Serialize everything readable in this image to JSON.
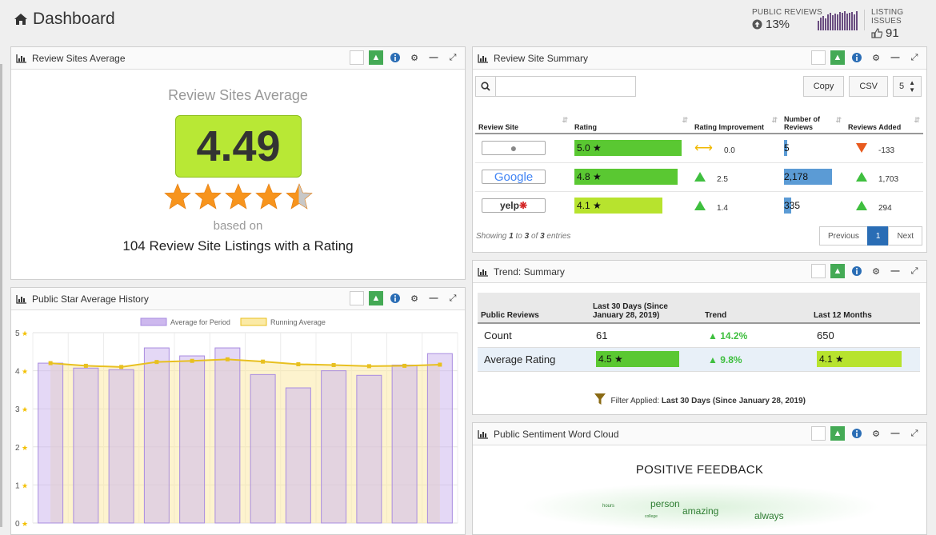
{
  "header": {
    "title": "Dashboard",
    "public_reviews_label": "PUBLIC REVIEWS",
    "public_reviews_value": "13%",
    "listing_issues_label": "LISTING ISSUES",
    "listing_issues_value": "91",
    "accent": "#6a4c80"
  },
  "review_sites_average": {
    "panel_title": "Review Sites Average",
    "heading": "Review Sites Average",
    "score": "4.49",
    "stars": 4.49,
    "based_on": "based on",
    "listing_text": "104 Review Site Listings with a Rating"
  },
  "review_site_summary": {
    "panel_title": "Review Site Summary",
    "copy_label": "Copy",
    "csv_label": "CSV",
    "page_size": "5",
    "columns": [
      "Review Site",
      "Rating",
      "Rating Improvement",
      "Number of Reviews",
      "Reviews Added"
    ],
    "rows": [
      {
        "site": "apple",
        "rating": "5.0",
        "rating_value": 5.0,
        "improvement": "0.0",
        "trend": "flat",
        "reviews": "5",
        "reviews_value": 5,
        "added": "-133",
        "added_trend": "down"
      },
      {
        "site": "Google",
        "rating": "4.8",
        "rating_value": 4.8,
        "improvement": "2.5",
        "trend": "up",
        "reviews": "2,178",
        "reviews_value": 2178,
        "added": "1,703",
        "added_trend": "up"
      },
      {
        "site": "yelp",
        "rating": "4.1",
        "rating_value": 4.1,
        "improvement": "1.4",
        "trend": "up",
        "reviews": "335",
        "reviews_value": 335,
        "added": "294",
        "added_trend": "up"
      }
    ],
    "showing_prefix": "Showing",
    "showing_from": "1",
    "showing_to_word": "to",
    "showing_to": "3",
    "showing_of_word": "of",
    "showing_total": "3",
    "showing_suffix": "entries",
    "previous_label": "Previous",
    "current_page": "1",
    "next_label": "Next"
  },
  "trend_summary": {
    "panel_title": "Trend: Summary",
    "columns": [
      "Public Reviews",
      "Last 30 Days (Since January 28, 2019)",
      "Trend",
      "Last 12 Months"
    ],
    "count_label": "Count",
    "count_30": "61",
    "count_trend": "14.2%",
    "count_12": "650",
    "avg_label": "Average Rating",
    "avg_30": "4.5",
    "avg_30_value": 4.5,
    "avg_trend": "9.8%",
    "avg_12": "4.1",
    "avg_12_value": 4.1,
    "filter_label": "Filter Applied:",
    "filter_value": "Last 30 Days (Since January 28, 2019)"
  },
  "word_cloud": {
    "panel_title": "Public Sentiment Word Cloud",
    "heading": "POSITIVE FEEDBACK",
    "words": [
      {
        "text": "person",
        "size": 12
      },
      {
        "text": "amazing",
        "size": 12
      },
      {
        "text": "always",
        "size": 12
      },
      {
        "text": "hours",
        "size": 6
      },
      {
        "text": "college",
        "size": 5
      }
    ]
  },
  "history": {
    "panel_title": "Public Star Average History"
  },
  "chart_data": {
    "type": "bar",
    "legend": [
      "Average for Period",
      "Running Average"
    ],
    "legend_placement": "top",
    "ylim": [
      0,
      5
    ],
    "y_ticks": [
      "0",
      "1",
      "2",
      "3",
      "4",
      "5"
    ],
    "series": [
      {
        "name": "Average for Period",
        "type": "bar",
        "values": [
          4.2,
          4.07,
          4.03,
          4.6,
          4.39,
          4.6,
          3.9,
          3.55,
          4.0,
          3.88,
          4.15,
          4.45
        ]
      },
      {
        "name": "Running Average",
        "type": "line",
        "values": [
          4.2,
          4.13,
          4.1,
          4.23,
          4.26,
          4.3,
          4.24,
          4.17,
          4.15,
          4.12,
          4.13,
          4.16
        ]
      }
    ],
    "bar_color": "#cdb8ee",
    "line_color": "#e8c020"
  }
}
